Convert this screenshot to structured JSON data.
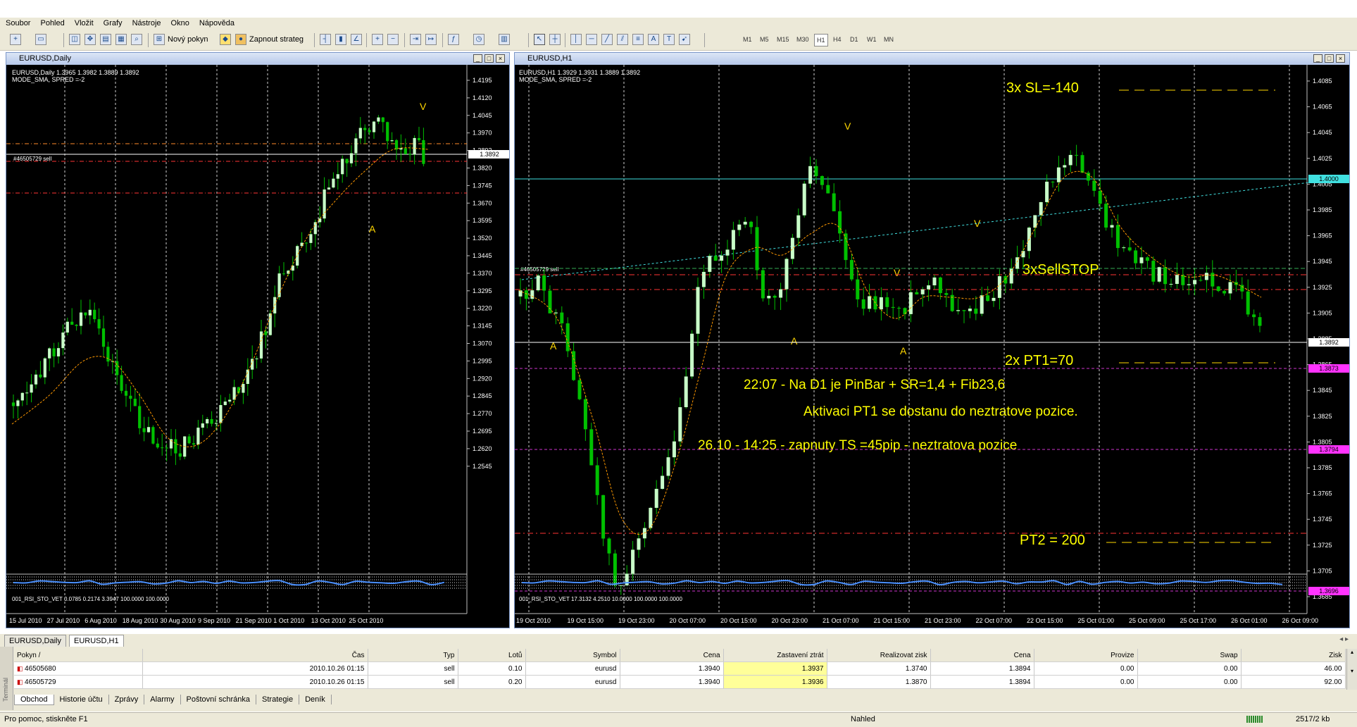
{
  "menu": [
    "Soubor",
    "Pohled",
    "Vložit",
    "Grafy",
    "Nástroje",
    "Okno",
    "Nápověda"
  ],
  "toolbar": {
    "new_order": "Nový pokyn",
    "autotrade": "Zapnout strateg",
    "timeframes": [
      "M1",
      "M5",
      "M15",
      "M30",
      "H1",
      "H4",
      "D1",
      "W1",
      "MN"
    ],
    "active_timeframe": "H1",
    "icons": [
      "new-chart-icon",
      "profiles-icon",
      "market-watch-icon",
      "navigator-icon",
      "data-window-icon",
      "terminal-icon",
      "new-order-icon",
      "autotrading-icon",
      "bar-chart-icon",
      "candle-chart-icon",
      "line-chart-icon",
      "zoom-in-icon",
      "zoom-out-icon",
      "chart-shift-icon",
      "autoscroll-icon",
      "indicators-icon",
      "periods-icon",
      "templates-icon",
      "cursor-icon",
      "crosshair-icon",
      "vertical-line-icon",
      "horizontal-line-icon",
      "trendline-icon",
      "equidistant-channel-icon",
      "fibonacci-icon",
      "text-icon",
      "text-label-icon",
      "arrows-icon"
    ]
  },
  "left_chart": {
    "title": "EURUSD,Daily",
    "info_line1": "EURUSD,Daily  1.3965 1.3982 1.3889 1.3892",
    "info_line2": "MODE_SMA, SPRED =-2",
    "order_label": "#46505729 sell",
    "price_ticks": [
      "1.4195",
      "1.4120",
      "1.4045",
      "1.3970",
      "1.3892",
      "1.3820",
      "1.3745",
      "1.3670",
      "1.3595",
      "1.3520",
      "1.3445",
      "1.3370",
      "1.3295",
      "1.3220",
      "1.3145",
      "1.3070",
      "1.2995",
      "1.2920",
      "1.2845",
      "1.2770",
      "1.2695",
      "1.2620",
      "1.2545"
    ],
    "current_price": "1.3892",
    "date_ticks": [
      "15 Jul 2010",
      "27 Jul 2010",
      "6 Aug 2010",
      "18 Aug 2010",
      "30 Aug 2010",
      "9 Sep 2010",
      "21 Sep 2010",
      "1 Oct 2010",
      "13 Oct 2010",
      "25 Oct 2010"
    ],
    "labels": {
      "v": "V",
      "a": "A"
    },
    "indicator_label": "001_RSI_STO_VET 0.0785 0.2174 3.3947 100.0000 100.0000"
  },
  "right_chart": {
    "title": "EURUSD,H1",
    "info_line1": "EURUSD,H1  1.3929 1.3931 1.3889 1.3892",
    "info_line2": "MODE_SMA, SPRED =-2",
    "order_label": "#46505729 sell",
    "price_ticks": [
      "1.4085",
      "1.4065",
      "1.4045",
      "1.4025",
      "1.4005",
      "1.3985",
      "1.3965",
      "1.3945",
      "1.3925",
      "1.3905",
      "1.3885",
      "1.3865",
      "1.3845",
      "1.3825",
      "1.3805",
      "1.3785",
      "1.3765",
      "1.3745",
      "1.3725",
      "1.3705",
      "1.3685"
    ],
    "badges": {
      "level_1": "1.4000",
      "current": "1.3892",
      "level_2": "1.3873",
      "level_3": "1.3794",
      "level_4": "1.3696"
    },
    "date_ticks": [
      "19 Oct 2010",
      "19 Oct 15:00",
      "19 Oct 23:00",
      "20 Oct 07:00",
      "20 Oct 15:00",
      "20 Oct 23:00",
      "21 Oct 07:00",
      "21 Oct 15:00",
      "21 Oct 23:00",
      "22 Oct 07:00",
      "22 Oct 15:00",
      "25 Oct 01:00",
      "25 Oct 09:00",
      "25 Oct 17:00",
      "26 Oct 01:00",
      "26 Oct 09:00"
    ],
    "labels": {
      "v": "V",
      "a": "A"
    },
    "annotations": {
      "sl": "3x SL=-140",
      "sellstop": "3xSellSTOP",
      "pt1": "2x PT1=70",
      "note1": "22:07 - Na D1 je PinBar + SR=1,4 + Fib23,6",
      "note2": "Aktivaci PT1 se dostanu do neztratove pozice.",
      "note3": "26.10 - 14:25 - zapnuty TS =45pip - neztratova pozice",
      "pt2": "PT2 = 200"
    },
    "indicator_label": "001_RSI_STO_VET 17.3132 4.2510 10.0000 100.0000 100.0000"
  },
  "chart_tabs": [
    "EURUSD,Daily",
    "EURUSD,H1"
  ],
  "active_chart_tab": "EURUSD,H1",
  "terminal": {
    "side_label": "Terminál",
    "columns": [
      "Pokyn  /",
      "Čas",
      "Typ",
      "Lotů",
      "Symbol",
      "Cena",
      "Zastavení ztrát",
      "Realizovat zisk",
      "Cena",
      "Provize",
      "Swap",
      "Zisk"
    ],
    "rows": [
      [
        "46505680",
        "2010.10.26 01:15",
        "sell",
        "0.10",
        "eurusd",
        "1.3940",
        "1.3937",
        "1.3740",
        "1.3894",
        "0.00",
        "0.00",
        "46.00"
      ],
      [
        "46505729",
        "2010.10.26 01:15",
        "sell",
        "0.20",
        "eurusd",
        "1.3940",
        "1.3936",
        "1.3870",
        "1.3894",
        "0.00",
        "0.00",
        "92.00"
      ]
    ],
    "tabs": [
      "Obchod",
      "Historie účtu",
      "Zprávy",
      "Alarmy",
      "Poštovní schránka",
      "Strategie",
      "Deník"
    ],
    "active_tab": "Obchod"
  },
  "status": {
    "help": "Pro pomoc, stiskněte F1",
    "profile": "Nahled",
    "traffic": "2517/2 kb"
  },
  "colors": {
    "bull_candle": "#c8ffc8",
    "bear_candle": "#00c000",
    "ma_line": "#ff9900",
    "annotation": "#ffff00",
    "sl_line": "#ff3333",
    "resistance_line": "#40e0e0",
    "pt_line": "#cc33cc"
  }
}
